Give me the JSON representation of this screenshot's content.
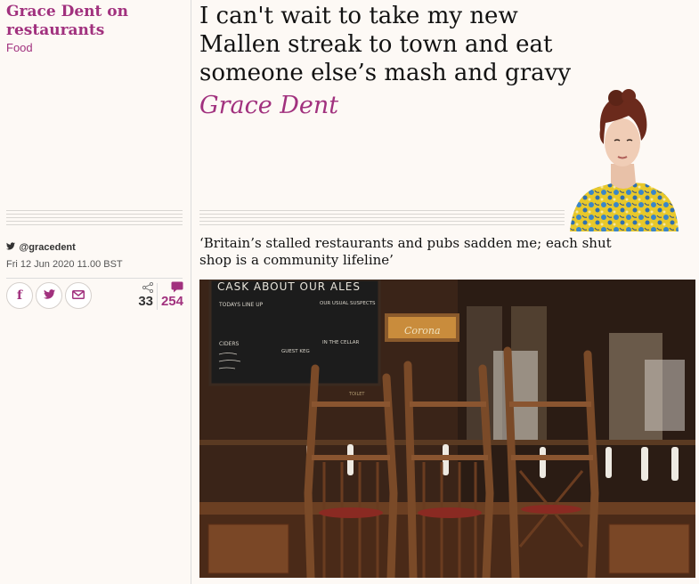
{
  "series": {
    "title": "Grace Dent on restaurants",
    "section": "Food"
  },
  "article": {
    "headline": "I can't wait to take my new Mallen streak to town and eat someone else’s mash and gravy",
    "byline": "Grace Dent",
    "standfirst": "‘Britain’s stalled restaurants and pubs sadden me; each shut shop is a community lifeline’",
    "twitter_handle": "@gracedent",
    "date": "Fri 12 Jun 2020 11.00 BST"
  },
  "share": {
    "buttons": [
      {
        "icon": "facebook-icon",
        "glyph": "f"
      },
      {
        "icon": "twitter-icon",
        "glyph": "🐦"
      },
      {
        "icon": "email-icon",
        "glyph": "✉"
      }
    ],
    "share_count": "33",
    "comment_count": "254"
  },
  "photo": {
    "chalkboard_heading": "CASK ABOUT OUR ALES",
    "chalkboard_line_1": "TODAYS LINE UP",
    "chalkboard_line_2": "OUR USUAL SUSPECTS",
    "chalkboard_line_3": "CIDERS",
    "chalkboard_line_4": "GUEST KEG",
    "chalkboard_line_5": "IN THE CELLAR",
    "crate_label": "Corona",
    "sign_label": "TOILET"
  },
  "colors": {
    "accent": "#a1317e",
    "background": "#fdf9f5"
  }
}
